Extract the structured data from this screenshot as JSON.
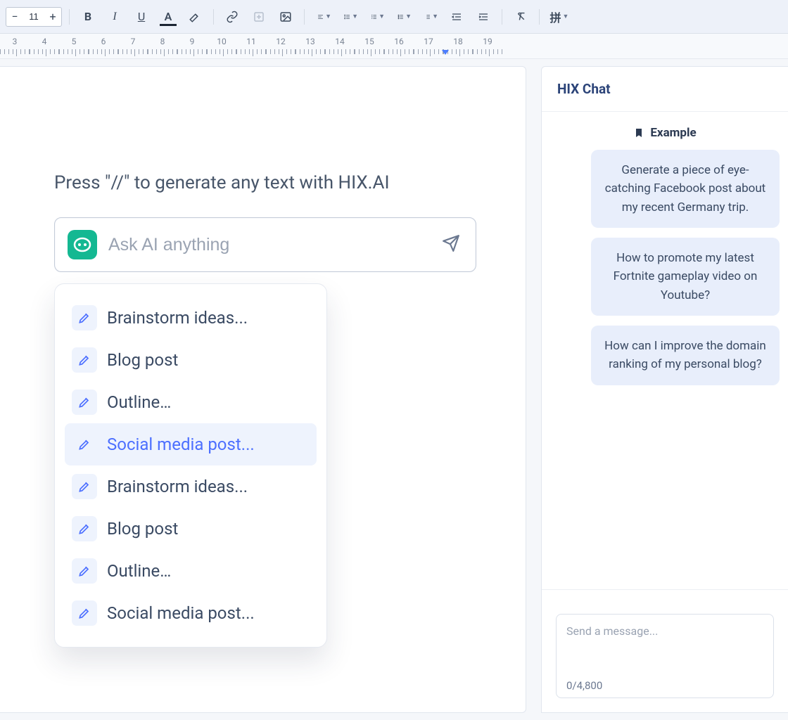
{
  "toolbar": {
    "font_size": "11"
  },
  "ruler": {
    "numbers": [
      "3",
      "4",
      "5",
      "6",
      "7",
      "8",
      "9",
      "10",
      "11",
      "12",
      "13",
      "14",
      "15",
      "16",
      "17",
      "18",
      "19"
    ]
  },
  "editor": {
    "hint": "Press  \"//\"  to generate any text with HIX.AI",
    "ask_placeholder": "Ask AI anything"
  },
  "suggestions": [
    {
      "label": "Brainstorm ideas...",
      "selected": false
    },
    {
      "label": "Blog post",
      "selected": false
    },
    {
      "label": "Outline…",
      "selected": false
    },
    {
      "label": "Social media post...",
      "selected": true
    },
    {
      "label": "Brainstorm ideas...",
      "selected": false
    },
    {
      "label": "Blog post",
      "selected": false
    },
    {
      "label": "Outline…",
      "selected": false
    },
    {
      "label": "Social media post...",
      "selected": false
    }
  ],
  "chat": {
    "title": "HIX Chat",
    "example_heading": "Example",
    "examples": [
      "Generate a piece of eye-catching Facebook post about my recent Germany trip.",
      "How to promote my latest Fortnite gameplay video on Youtube?",
      "How can I improve the domain ranking of my personal blog?"
    ],
    "message_placeholder": "Send a message...",
    "counter": "0/4,800"
  }
}
